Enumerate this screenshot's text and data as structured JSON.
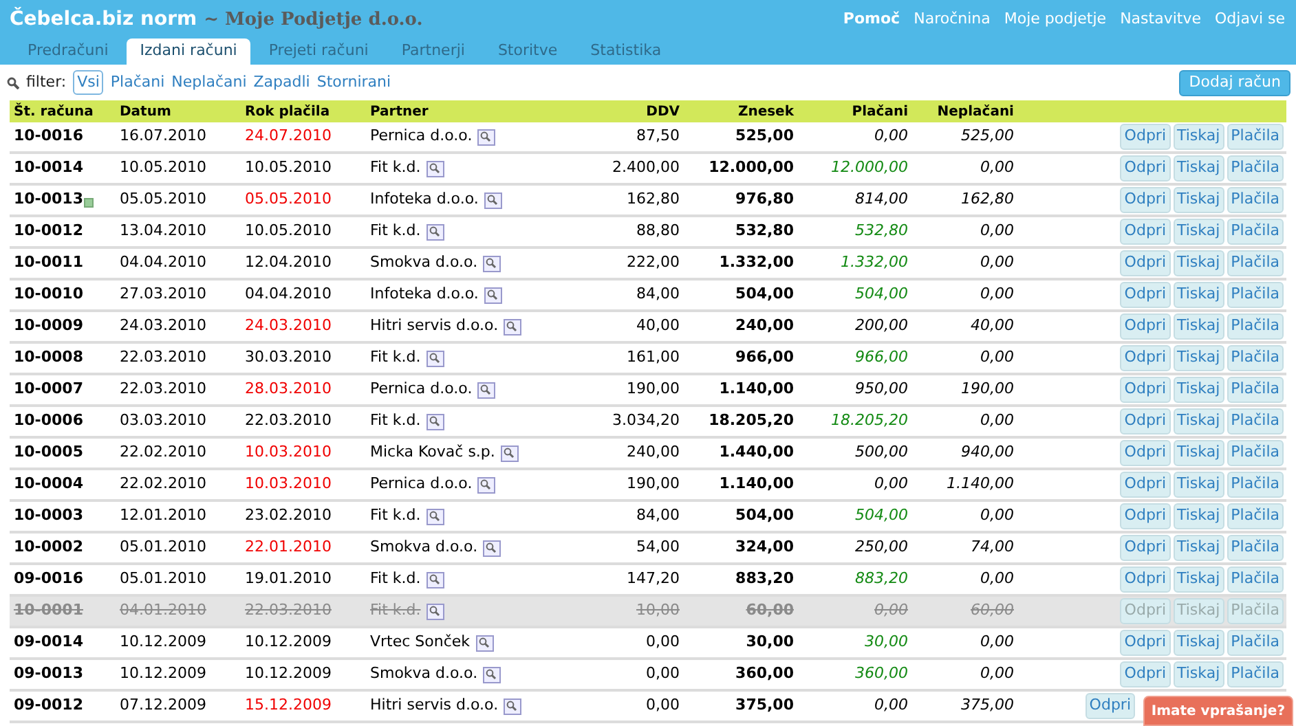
{
  "header": {
    "app_name": "Čebelca.biz norm",
    "company": "~ Moje Podjetje d.o.o.",
    "nav": [
      {
        "label": "Pomoč",
        "bold": true
      },
      {
        "label": "Naročnina",
        "bold": false
      },
      {
        "label": "Moje podjetje",
        "bold": false
      },
      {
        "label": "Nastavitve",
        "bold": false
      },
      {
        "label": "Odjavi se",
        "bold": false
      }
    ]
  },
  "tabs": [
    {
      "label": "Predračuni",
      "selected": false
    },
    {
      "label": "Izdani računi",
      "selected": true
    },
    {
      "label": "Prejeti računi",
      "selected": false
    },
    {
      "label": "Partnerji",
      "selected": false
    },
    {
      "label": "Storitve",
      "selected": false
    },
    {
      "label": "Statistika",
      "selected": false
    }
  ],
  "filter": {
    "label": "filter:",
    "options": [
      {
        "label": "Vsi",
        "selected": true
      },
      {
        "label": "Plačani",
        "selected": false
      },
      {
        "label": "Neplačani",
        "selected": false
      },
      {
        "label": "Zapadli",
        "selected": false
      },
      {
        "label": "Stornirani",
        "selected": false
      }
    ]
  },
  "add_button": "Dodaj račun",
  "table": {
    "columns": [
      "Št. računa",
      "Datum",
      "Rok plačila",
      "Partner",
      "DDV",
      "Znesek",
      "Plačani",
      "Neplačani"
    ],
    "rows": [
      {
        "number": "10-0016",
        "note": false,
        "date": "16.07.2010",
        "due": "24.07.2010",
        "overdue": true,
        "partner": "Pernica d.o.o.",
        "ddv": "87,50",
        "amount": "525,00",
        "paid": "0,00",
        "paid_in_full": false,
        "unpaid": "525,00",
        "cancelled": false,
        "actions": [
          "Odpri",
          "Tiskaj",
          "Plačila"
        ]
      },
      {
        "number": "10-0014",
        "note": false,
        "date": "10.05.2010",
        "due": "10.05.2010",
        "overdue": false,
        "partner": "Fit k.d.",
        "ddv": "2.400,00",
        "amount": "12.000,00",
        "paid": "12.000,00",
        "paid_in_full": true,
        "unpaid": "0,00",
        "cancelled": false,
        "actions": [
          "Odpri",
          "Tiskaj",
          "Plačila"
        ]
      },
      {
        "number": "10-0013",
        "note": true,
        "date": "05.05.2010",
        "due": "05.05.2010",
        "overdue": true,
        "partner": "Infoteka d.o.o.",
        "ddv": "162,80",
        "amount": "976,80",
        "paid": "814,00",
        "paid_in_full": false,
        "unpaid": "162,80",
        "cancelled": false,
        "actions": [
          "Odpri",
          "Tiskaj",
          "Plačila"
        ]
      },
      {
        "number": "10-0012",
        "note": false,
        "date": "13.04.2010",
        "due": "10.05.2010",
        "overdue": false,
        "partner": "Fit k.d.",
        "ddv": "88,80",
        "amount": "532,80",
        "paid": "532,80",
        "paid_in_full": true,
        "unpaid": "0,00",
        "cancelled": false,
        "actions": [
          "Odpri",
          "Tiskaj",
          "Plačila"
        ]
      },
      {
        "number": "10-0011",
        "note": false,
        "date": "04.04.2010",
        "due": "12.04.2010",
        "overdue": false,
        "partner": "Smokva d.o.o.",
        "ddv": "222,00",
        "amount": "1.332,00",
        "paid": "1.332,00",
        "paid_in_full": true,
        "unpaid": "0,00",
        "cancelled": false,
        "actions": [
          "Odpri",
          "Tiskaj",
          "Plačila"
        ]
      },
      {
        "number": "10-0010",
        "note": false,
        "date": "27.03.2010",
        "due": "04.04.2010",
        "overdue": false,
        "partner": "Infoteka d.o.o.",
        "ddv": "84,00",
        "amount": "504,00",
        "paid": "504,00",
        "paid_in_full": true,
        "unpaid": "0,00",
        "cancelled": false,
        "actions": [
          "Odpri",
          "Tiskaj",
          "Plačila"
        ]
      },
      {
        "number": "10-0009",
        "note": false,
        "date": "24.03.2010",
        "due": "24.03.2010",
        "overdue": true,
        "partner": "Hitri servis d.o.o.",
        "ddv": "40,00",
        "amount": "240,00",
        "paid": "200,00",
        "paid_in_full": false,
        "unpaid": "40,00",
        "cancelled": false,
        "actions": [
          "Odpri",
          "Tiskaj",
          "Plačila"
        ]
      },
      {
        "number": "10-0008",
        "note": false,
        "date": "22.03.2010",
        "due": "30.03.2010",
        "overdue": false,
        "partner": "Fit k.d.",
        "ddv": "161,00",
        "amount": "966,00",
        "paid": "966,00",
        "paid_in_full": true,
        "unpaid": "0,00",
        "cancelled": false,
        "actions": [
          "Odpri",
          "Tiskaj",
          "Plačila"
        ]
      },
      {
        "number": "10-0007",
        "note": false,
        "date": "22.03.2010",
        "due": "28.03.2010",
        "overdue": true,
        "partner": "Pernica d.o.o.",
        "ddv": "190,00",
        "amount": "1.140,00",
        "paid": "950,00",
        "paid_in_full": false,
        "unpaid": "190,00",
        "cancelled": false,
        "actions": [
          "Odpri",
          "Tiskaj",
          "Plačila"
        ]
      },
      {
        "number": "10-0006",
        "note": false,
        "date": "03.03.2010",
        "due": "22.03.2010",
        "overdue": false,
        "partner": "Fit k.d.",
        "ddv": "3.034,20",
        "amount": "18.205,20",
        "paid": "18.205,20",
        "paid_in_full": true,
        "unpaid": "0,00",
        "cancelled": false,
        "actions": [
          "Odpri",
          "Tiskaj",
          "Plačila"
        ]
      },
      {
        "number": "10-0005",
        "note": false,
        "date": "22.02.2010",
        "due": "10.03.2010",
        "overdue": true,
        "partner": "Micka Kovač s.p.",
        "ddv": "240,00",
        "amount": "1.440,00",
        "paid": "500,00",
        "paid_in_full": false,
        "unpaid": "940,00",
        "cancelled": false,
        "actions": [
          "Odpri",
          "Tiskaj",
          "Plačila"
        ]
      },
      {
        "number": "10-0004",
        "note": false,
        "date": "22.02.2010",
        "due": "10.03.2010",
        "overdue": true,
        "partner": "Pernica d.o.o.",
        "ddv": "190,00",
        "amount": "1.140,00",
        "paid": "0,00",
        "paid_in_full": false,
        "unpaid": "1.140,00",
        "cancelled": false,
        "actions": [
          "Odpri",
          "Tiskaj",
          "Plačila"
        ]
      },
      {
        "number": "10-0003",
        "note": false,
        "date": "12.01.2010",
        "due": "23.02.2010",
        "overdue": false,
        "partner": "Fit k.d.",
        "ddv": "84,00",
        "amount": "504,00",
        "paid": "504,00",
        "paid_in_full": true,
        "unpaid": "0,00",
        "cancelled": false,
        "actions": [
          "Odpri",
          "Tiskaj",
          "Plačila"
        ]
      },
      {
        "number": "10-0002",
        "note": false,
        "date": "05.01.2010",
        "due": "22.01.2010",
        "overdue": true,
        "partner": "Smokva d.o.o.",
        "ddv": "54,00",
        "amount": "324,00",
        "paid": "250,00",
        "paid_in_full": false,
        "unpaid": "74,00",
        "cancelled": false,
        "actions": [
          "Odpri",
          "Tiskaj",
          "Plačila"
        ]
      },
      {
        "number": "09-0016",
        "note": false,
        "date": "05.01.2010",
        "due": "19.01.2010",
        "overdue": false,
        "partner": "Fit k.d.",
        "ddv": "147,20",
        "amount": "883,20",
        "paid": "883,20",
        "paid_in_full": true,
        "unpaid": "0,00",
        "cancelled": false,
        "actions": [
          "Odpri",
          "Tiskaj",
          "Plačila"
        ]
      },
      {
        "number": "10-0001",
        "note": false,
        "date": "04.01.2010",
        "due": "22.03.2010",
        "partner": "Fit k.d.",
        "ddv": "10,00",
        "amount": "60,00",
        "paid": "0,00",
        "unpaid": "60,00",
        "cancelled": true,
        "actions": [
          "Odpri",
          "Tiskaj",
          "Plačila"
        ]
      },
      {
        "number": "09-0014",
        "note": false,
        "date": "10.12.2009",
        "due": "10.12.2009",
        "overdue": false,
        "partner": "Vrtec Sonček",
        "ddv": "0,00",
        "amount": "30,00",
        "paid": "30,00",
        "paid_in_full": true,
        "unpaid": "0,00",
        "cancelled": false,
        "actions": [
          "Odpri",
          "Tiskaj",
          "Plačila"
        ]
      },
      {
        "number": "09-0013",
        "note": false,
        "date": "10.12.2009",
        "due": "10.12.2009",
        "overdue": false,
        "partner": "Smokva d.o.o.",
        "ddv": "0,00",
        "amount": "360,00",
        "paid": "360,00",
        "paid_in_full": true,
        "unpaid": "0,00",
        "cancelled": false,
        "actions": [
          "Odpri",
          "Tiskaj",
          "Plačila"
        ]
      },
      {
        "number": "09-0012",
        "note": false,
        "date": "07.12.2009",
        "due": "15.12.2009",
        "overdue": true,
        "partner": "Hitri servis d.o.o.",
        "ddv": "0,00",
        "amount": "375,00",
        "paid": "0,00",
        "paid_in_full": false,
        "unpaid": "375,00",
        "cancelled": false,
        "actions": [
          "Odpri"
        ]
      }
    ]
  },
  "help_tab": "Imate vprašanje?"
}
